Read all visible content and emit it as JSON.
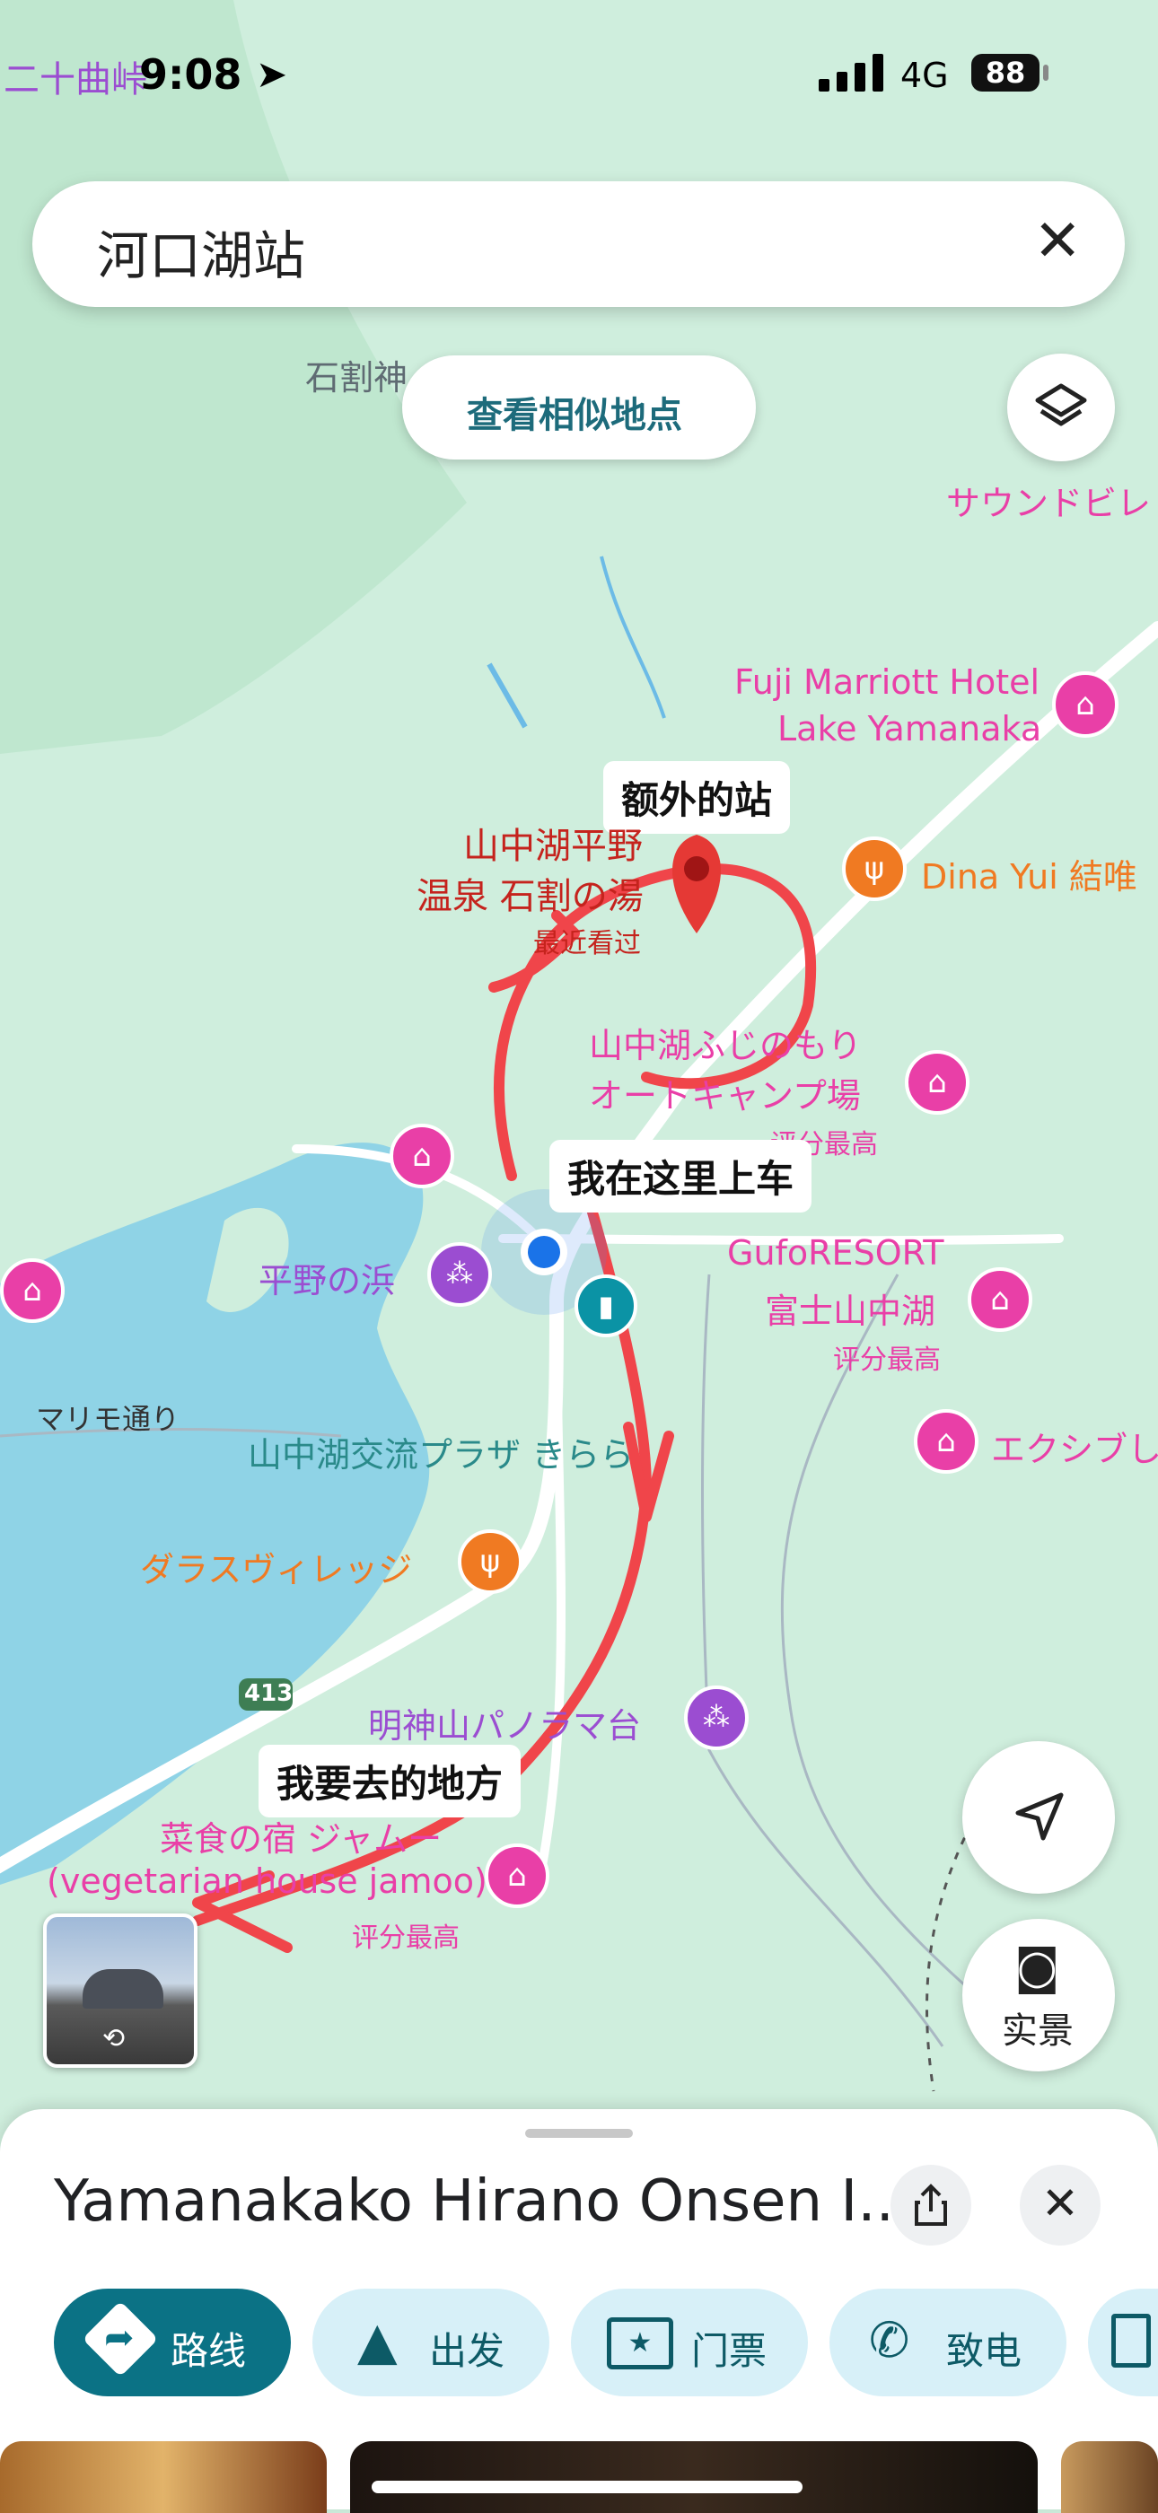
{
  "status_bar": {
    "time": "9:08",
    "network": "4G",
    "battery": "88"
  },
  "search": {
    "query": "河口湖站"
  },
  "map_buttons": {
    "similar_places": "查看相似地点",
    "street_view": "实景"
  },
  "map_labels": {
    "top_left_place": "二十曲峠",
    "shrine": "石割神",
    "top_right": "サウンドビレ",
    "marriott_line1": "Fuji Marriott Hotel",
    "marriott_line2": "Lake Yamanaka",
    "dina_yui": "Dina Yui 結唯",
    "onsen_line1": "山中湖平野",
    "onsen_line2": "温泉 石割の湯",
    "recently_viewed": "最近看过",
    "camp_line1": "山中湖ふじのもり",
    "camp_line2": "オートキャンプ場",
    "top_rated": "评分最高",
    "hirano_beach": "平野の浜",
    "gufo_line1": "GufoRESORT",
    "gufo_line2": "富士山中湖",
    "gufo_rating": "评分最高",
    "exhibition": "エクシブし",
    "marimo": "マリモ通り",
    "kirara": "山中湖交流プラザ きらら",
    "dallas": "ダラスヴィレッジ",
    "route_413": "413",
    "myojin": "明神山パノラマ台",
    "jamoo_line1": "菜食の宿 ジャムー",
    "jamoo_line2": "(vegetarian house jamoo)",
    "jamoo_rating": "评分最高"
  },
  "annotations": {
    "extra_stop": "额外的站",
    "board_here": "我在这里上车",
    "destination": "我要去的地方"
  },
  "place_sheet": {
    "title": "Yamanakako Hirano Onsen I...",
    "actions": [
      {
        "label": "路线",
        "icon": "directions-icon"
      },
      {
        "label": "出发",
        "icon": "navigate-arrow-icon"
      },
      {
        "label": "门票",
        "icon": "ticket-icon"
      },
      {
        "label": "致电",
        "icon": "phone-icon"
      }
    ]
  },
  "colors": {
    "map_land": "#cfeedd",
    "lake": "#8fd3e6",
    "route_red": "#f0454a",
    "hotel_pink": "#e93fa7",
    "restaurant_orange": "#f07a22",
    "attraction_purple": "#9b4dd1",
    "place_red": "#c5231d",
    "primary_teal": "#0b7285"
  }
}
